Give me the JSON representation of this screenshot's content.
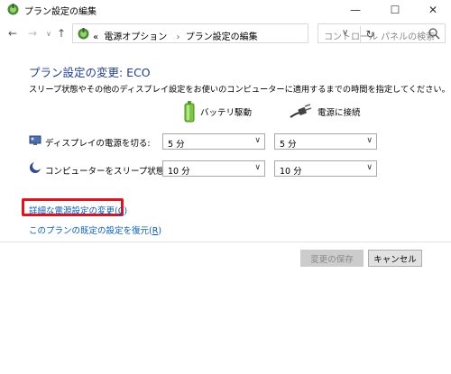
{
  "window": {
    "title": "プラン設定の編集",
    "controls": {
      "minimize": "—",
      "maximize": "☐",
      "close": "✕"
    }
  },
  "nav": {
    "back": "←",
    "forward": "→",
    "recent": "∨",
    "up": "↑",
    "address_prefix": "«",
    "breadcrumbs": [
      "電源オプション",
      "プラン設定の編集"
    ],
    "separator": "›",
    "dropdown": "∨",
    "refresh": "↻",
    "search_placeholder": "コントロール パネルの検索"
  },
  "main": {
    "title": "プラン設定の変更: ECO",
    "description": "スリープ状態やその他のディスプレイ設定をお使いのコンピューターに適用するまでの時間を指定してください。",
    "columns": {
      "battery": "バッテリ駆動",
      "plugged": "電源に接続"
    },
    "rows": [
      {
        "label": "ディスプレイの電源を切る:",
        "battery": "5 分",
        "plugged": "5 分"
      },
      {
        "label": "コンピューターをスリープ状態にする:",
        "battery": "10 分",
        "plugged": "10 分"
      }
    ],
    "advanced_link": {
      "text": "詳細な電源設定の変更(",
      "key": "C",
      "close": ")"
    },
    "restore_link": {
      "text": "このプランの既定の設定を復元(",
      "key": "R",
      "close": ")"
    }
  },
  "buttons": {
    "save": "変更の保存",
    "cancel": "キャンセル"
  },
  "colors": {
    "title": "#1e3d8f",
    "link": "#0a5bb5",
    "highlight": "#e0141e"
  }
}
